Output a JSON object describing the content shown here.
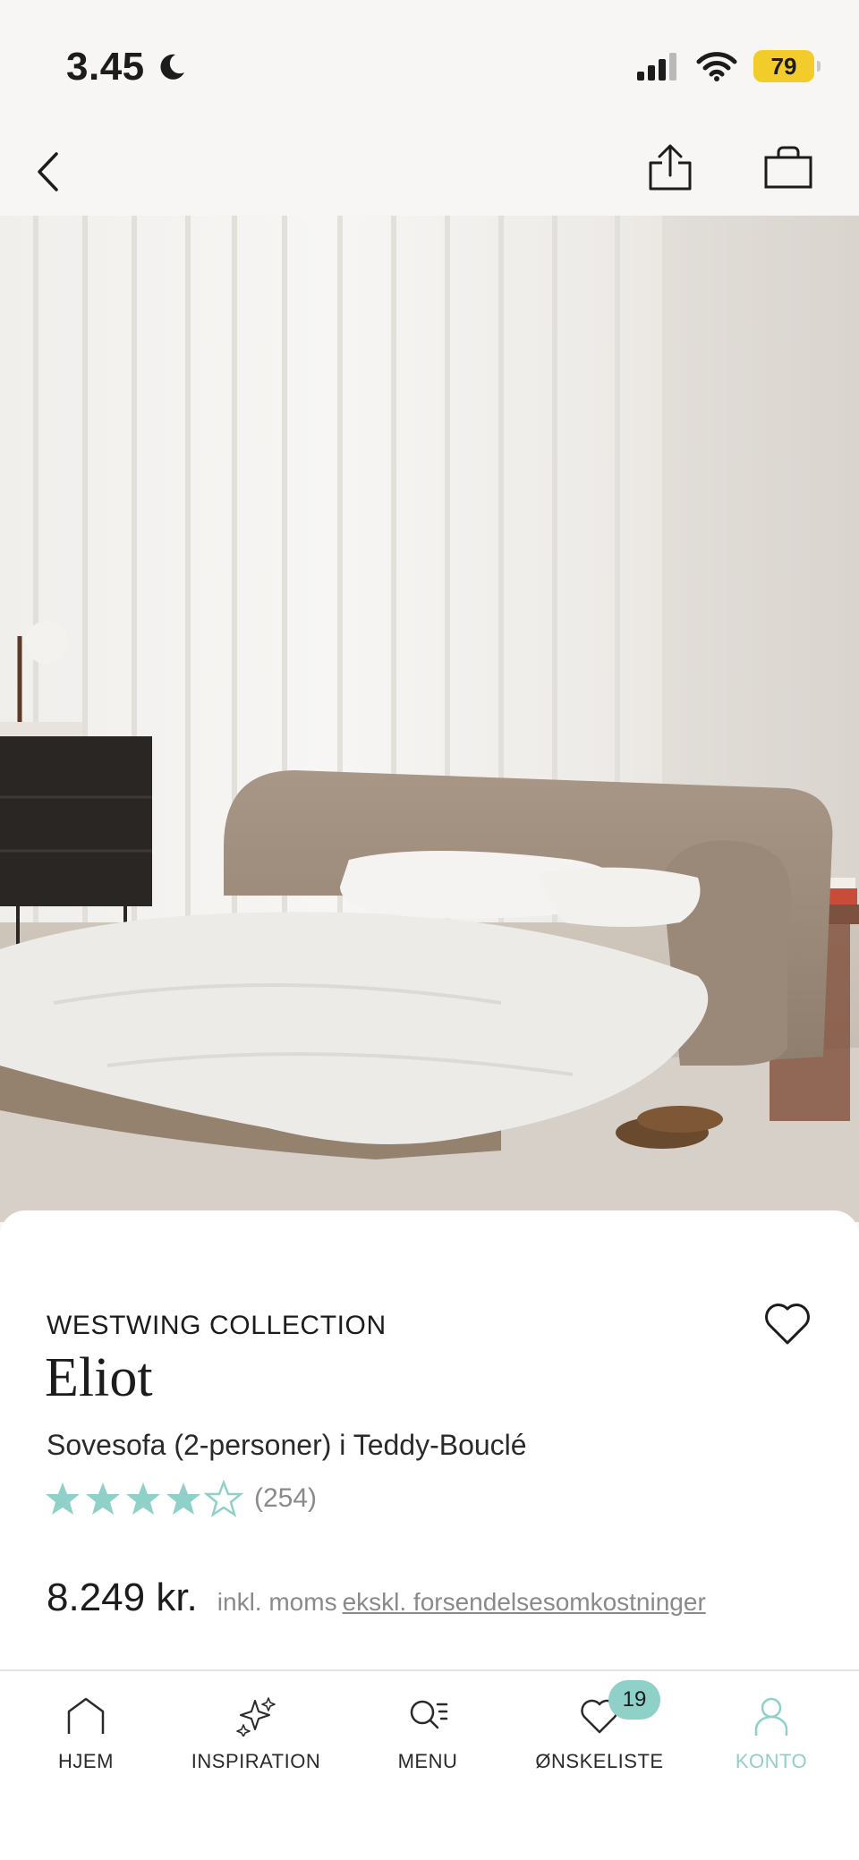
{
  "status_bar": {
    "time": "3.45",
    "battery": "79",
    "icons": [
      "moon-icon",
      "cellular-signal-icon",
      "wifi-icon",
      "battery-icon"
    ]
  },
  "top_nav": {
    "icons": [
      "back-chevron-icon",
      "share-icon",
      "shopping-bag-icon"
    ]
  },
  "hero": {
    "image": "sofa-bed-photo",
    "colors": {
      "wall": "#ebe7e2",
      "curtain": "#f3f1ee",
      "sofa": "#a08f80",
      "bedding": "#ecebe8",
      "floor": "#cfc8bf"
    }
  },
  "product": {
    "brand": "WESTWING COLLECTION",
    "name": "Eliot",
    "subtitle": "Sovesofa (2-personer) i Teddy-Bouclé",
    "rating": 4.5,
    "rating_max": 5,
    "review_count": "(254)",
    "price": "8.249 kr.",
    "vat_note": "inkl. moms",
    "shipping_link": "ekskl. forsendelsesomkostninger",
    "accent_color": "#8fd0c8"
  },
  "tab_bar": {
    "tabs": [
      {
        "label": "HJEM",
        "icon": "home-icon"
      },
      {
        "label": "INSPIRATION",
        "icon": "sparkles-icon"
      },
      {
        "label": "MENU",
        "icon": "search-menu-icon"
      },
      {
        "label": "ØNSKELISTE",
        "icon": "heart-icon",
        "badge": "19"
      },
      {
        "label": "KONTO",
        "icon": "account-icon",
        "active": true
      }
    ]
  }
}
